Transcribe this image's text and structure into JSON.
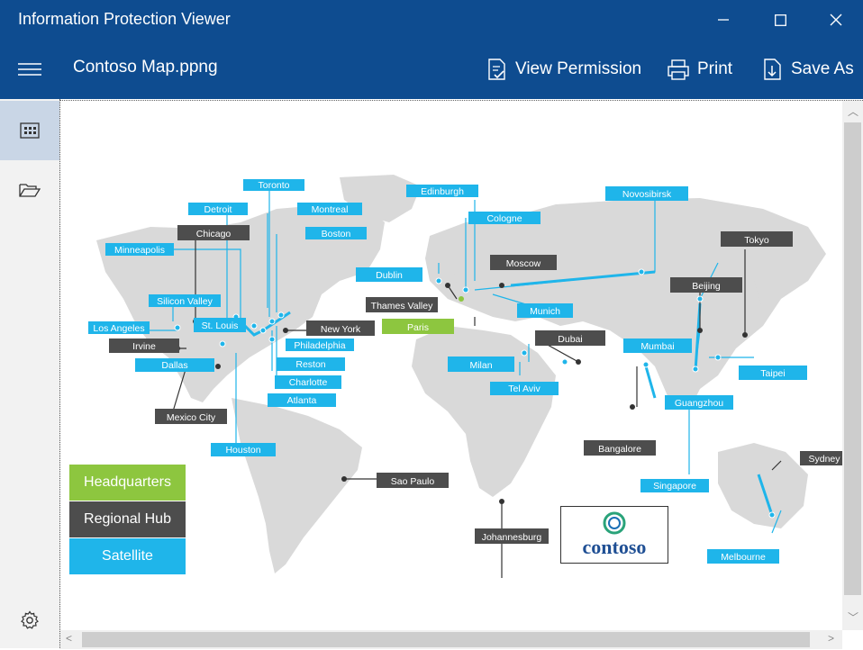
{
  "window": {
    "title": "Information Protection Viewer"
  },
  "toolbar": {
    "file_name": "Contoso Map.ppng",
    "view_permission": "View Permission",
    "print": "Print",
    "save_as": "Save As"
  },
  "colors": {
    "headquarters": "#8dc63f",
    "regional": "#4d4d4d",
    "satellite": "#1fb5ea",
    "brand": "#0e4c90",
    "land": "#d9d9d9"
  },
  "legend": {
    "hq": "Headquarters",
    "regional": "Regional Hub",
    "satellite": "Satellite"
  },
  "logo": {
    "text": "contoso"
  },
  "cities": {
    "toronto": "Toronto",
    "detroit": "Detroit",
    "montreal": "Montreal",
    "chicago": "Chicago",
    "boston": "Boston",
    "minneapolis": "Minneapolis",
    "silicon_valley": "Silicon Valley",
    "los_angeles": "Los Angeles",
    "st_louis": "St. Louis",
    "new_york": "New York",
    "irvine": "Irvine",
    "philadelphia": "Philadelphia",
    "dallas": "Dallas",
    "reston": "Reston",
    "charlotte": "Charlotte",
    "atlanta": "Atlanta",
    "mexico_city": "Mexico City",
    "houston": "Houston",
    "edinburgh": "Edinburgh",
    "cologne": "Cologne",
    "dublin": "Dublin",
    "thames_valley": "Thames Valley",
    "paris": "Paris",
    "moscow": "Moscow",
    "munich": "Munich",
    "milan": "Milan",
    "tel_aviv": "Tel Aviv",
    "dubai": "Dubai",
    "novosibirsk": "Novosibirsk",
    "tokyo": "Tokyo",
    "beijing": "Beijing",
    "mumbai": "Mumbai",
    "taipei": "Taipei",
    "guangzhou": "Guangzhou",
    "bangalore": "Bangalore",
    "singapore": "Singapore",
    "sydney": "Sydney",
    "melbourne": "Melbourne",
    "sao_paulo": "Sao Paulo",
    "johannesburg": "Johannesburg"
  }
}
